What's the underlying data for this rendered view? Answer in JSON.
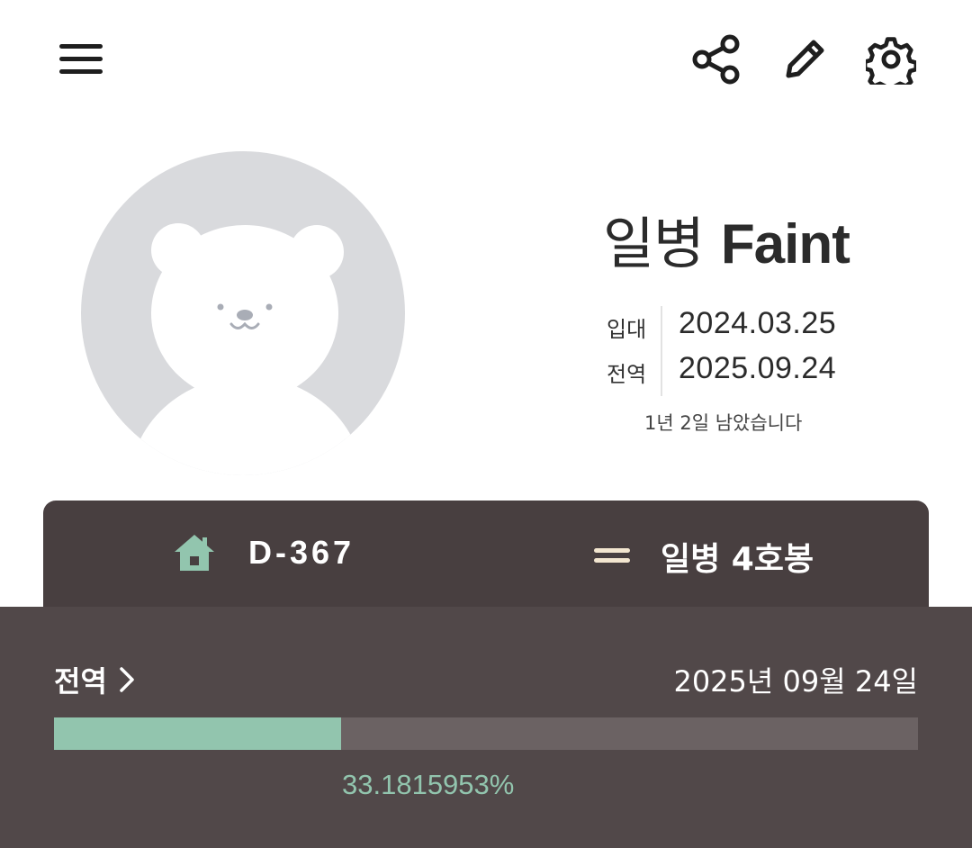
{
  "header": {
    "menu_icon": "hamburger-menu-icon",
    "share_icon": "share-icon",
    "edit_icon": "pencil-icon",
    "settings_icon": "gear-icon"
  },
  "profile": {
    "avatar_icon": "bear-avatar-icon",
    "rank": "일병",
    "nickname": "Faint",
    "enlist_label": "입대",
    "enlist_date": "2024.03.25",
    "discharge_label": "전역",
    "discharge_date": "2025.09.24",
    "remaining_text": "1년 2일 남았습니다"
  },
  "stats": {
    "dday_icon": "home-icon",
    "dday": "D-367",
    "rank_icon": "rank-stripes-icon",
    "rank_step": "일병 4호봉"
  },
  "progress": {
    "title": "전역",
    "date_text": "2025년 09월 24일",
    "percent": 33.1815953,
    "percent_text": "33.1815953%"
  },
  "colors": {
    "accent": "#92c5ae",
    "card_bg": "#483f40",
    "panel_bg": "#514849",
    "rank_icon": "#f3e6d0",
    "avatar_bg": "#d9dadd"
  }
}
